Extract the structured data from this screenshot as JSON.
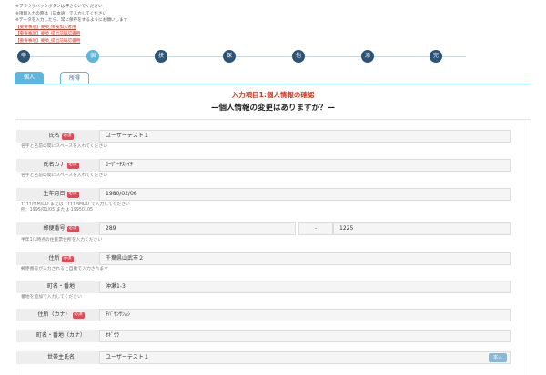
{
  "notices": {
    "notes": [
      "※ブラウザバックボタンは押さないでください",
      "※項目入力の際は（日本語）で入力してください",
      "※データを入力したら、常に保存をするようにお願いします"
    ],
    "links": [
      "【重要事項】要項_保険加入者用",
      "【重要事項】要項_提出前確認書用",
      "【重要事項】要項_提出前確認書用"
    ]
  },
  "steps": [
    {
      "label": "申",
      "active": false
    },
    {
      "label": "個",
      "active": true
    },
    {
      "label": "扶",
      "active": false
    },
    {
      "label": "保",
      "active": false
    },
    {
      "label": "他",
      "active": false
    },
    {
      "label": "添",
      "active": false
    },
    {
      "label": "完",
      "active": false
    }
  ],
  "tabs": {
    "individual": "個人",
    "office": "所得"
  },
  "section": {
    "title": "入力項目1:個人情報の確認",
    "subtitle": "—個人情報の変更はありますか？—"
  },
  "required_badge": "必須",
  "form": {
    "name": {
      "label": "氏名",
      "value": "ユーザーテスト１",
      "hint": "名字と名前の間にスペースを入れてください"
    },
    "name_kana": {
      "label": "氏名カナ",
      "value": "ﾕｰｻﾞｰﾃｽﾄｲﾁ",
      "hint": "名字と名前の間にスペースを入れてください"
    },
    "birth": {
      "label": "生年月日",
      "value": "1980/02/06",
      "hint1": "YYYY/MM/DD または YYYYMMDD で入力してください",
      "hint2": "例：1995/01/05 または 19950105"
    },
    "postal": {
      "label": "郵便番号",
      "value_a": "289",
      "separator": "-",
      "value_b": "1225",
      "hint": "半年1/1時点の住民票住所を入力ください"
    },
    "address": {
      "label": "住所",
      "value": "千葉県山武市２",
      "hint": "郵便番号が入力されると自動で入力されます"
    },
    "street": {
      "label": "町名・番地",
      "value": "沖瀬1-3",
      "hint": "番地を追加で入力してください"
    },
    "address_kana": {
      "label": "住所（カナ）",
      "value": "ﾁﾊﾞｹﾝｻﾝﾑｼ"
    },
    "street_kana": {
      "label": "町名・番地（カナ）",
      "value": "ｵｷﾞｳﾗ"
    },
    "head": {
      "label": "世帯主氏名",
      "value": "ユーザーテスト１",
      "button": "本人"
    }
  }
}
